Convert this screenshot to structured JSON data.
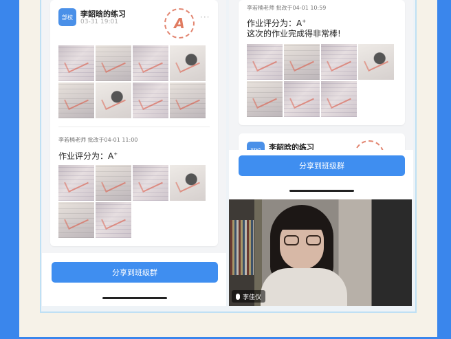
{
  "left_phone": {
    "card1": {
      "avatar_text": "部校",
      "author": "李韶晗的练习",
      "date": "03-31 19:01",
      "more": "···",
      "stamp_text": "A",
      "grader": "李若楠老师 批改于04-01 11:00",
      "grade_text": "作业评分为：A",
      "grade_sup": "+"
    },
    "share_button": "分享到班级群"
  },
  "right_phone": {
    "card1": {
      "grader": "李若楠老师 批改于04-01 10:59",
      "grade_text": "作业评分为：A",
      "grade_sup": "+",
      "comment": "这次的作业完成得非常棒!"
    },
    "card2": {
      "avatar_text": "部校",
      "author": "李韶晗的练习"
    },
    "share_button": "分享到班级群"
  },
  "video": {
    "participant_name": "李佳仪"
  },
  "colors": {
    "background": "#3a86ec",
    "accent": "#3f8ef0",
    "stamp": "#e07b60"
  }
}
